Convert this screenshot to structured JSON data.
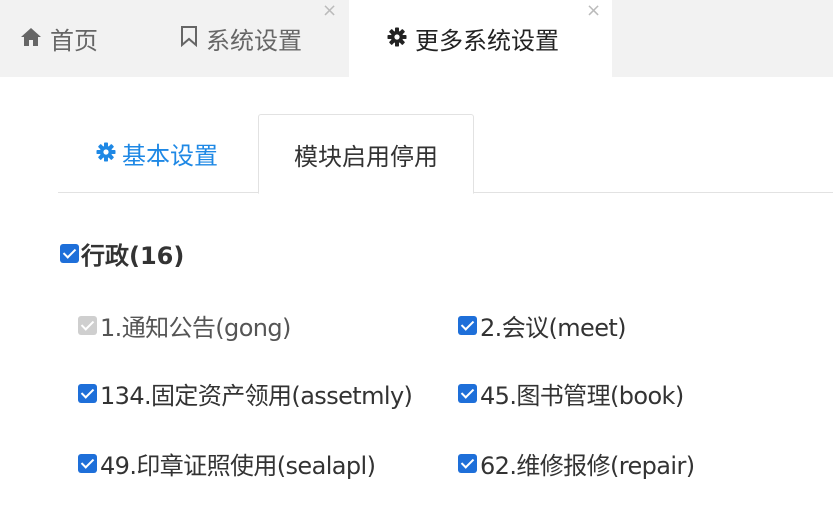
{
  "top_tabs": [
    {
      "label": "首页",
      "icon": "home-icon",
      "active": false
    },
    {
      "label": "系统设置",
      "icon": "bookmark-icon",
      "active": false,
      "closable": true
    },
    {
      "label": "更多系统设置",
      "icon": "gear-icon",
      "active": true,
      "closable": true
    }
  ],
  "close_glyph": "×",
  "inner_tabs": [
    {
      "label": "基本设置",
      "icon": "gear-icon"
    },
    {
      "label": "模块启用停用",
      "active": true
    }
  ],
  "group": {
    "label": "行政(16)",
    "checked": true
  },
  "modules": [
    {
      "label": "1.通知公告(gong)",
      "checked": true,
      "disabled": true
    },
    {
      "label": "2.会议(meet)",
      "checked": true
    },
    {
      "label": "134.固定资产领用(assetmly)",
      "checked": true
    },
    {
      "label": "45.图书管理(book)",
      "checked": true
    },
    {
      "label": "49.印章证照使用(sealapl)",
      "checked": true
    },
    {
      "label": "62.维修报修(repair)",
      "checked": true
    }
  ],
  "colors": {
    "accent": "#1e88e5",
    "checkbox": "#1e6fd9",
    "topbar": "#f2f2f2"
  }
}
